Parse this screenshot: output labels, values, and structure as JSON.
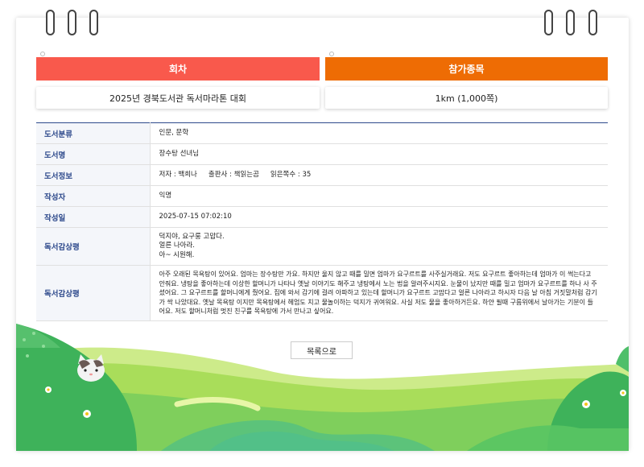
{
  "episode": {
    "header": "회차",
    "value": "2025년 경북도서관 독서마라톤 대회",
    "header_color": "#f9594c"
  },
  "category": {
    "header": "참가종목",
    "value": "1km (1,000쪽)",
    "header_color": "#ee6c04"
  },
  "table": {
    "rows": [
      {
        "label": "도서분류",
        "value": "인문, 문학"
      },
      {
        "label": "도서명",
        "value": "장수탕 선녀님"
      },
      {
        "label": "도서정보",
        "author": "저자 : 백희나",
        "publisher": "출판사 : 책읽는곰",
        "pages": "읽은쪽수 : 35"
      },
      {
        "label": "작성자",
        "value": "익명"
      },
      {
        "label": "작성일",
        "value": "2025-07-15 07:02:10"
      },
      {
        "label": "독서감상평",
        "lines": [
          "덕지야, 요구룽 고맙다.",
          "얼른 나아라.",
          "아~ 시원해."
        ]
      },
      {
        "label": "독서감상평",
        "value": "아주 오래된 목욕탕이 있어요. 엄마는 장수탕만 가요. 하지만 울지 않고 때를 밀면 엄마가 요구르트를 사주실거래요. 저도 요구르트 좋아하는데 엄마가 이 썩는다고 안줘요. 냉탕을 좋아하는데 이상한 할머니가 나타나 옛날 이야기도 해주고 냉탕에서 노는 법을 알려주시지요. 눈물이 났지만 때를 밀고 엄마가 요구르트를 하나 사 주셨어요. 그 요구르트를 할머니에게 줬어요. 집에 와서 감기에 걸려 아파하고 있는데 할머니가 요구르트 고맙다고 얼른 나아라고 하시자 다음 날 아침 거짓말처럼 감기가 싹 나았대요. 옛날 목욕탕 이지만 목욕탕에서 헤엄도 치고 물놀이하는 덕지가 귀여워요. 사실 저도 물을 좋아하거든요. 하얀 필때 구름위에서 날아가는 기분이 들어요. 저도 할머니처럼 멋진 친구를 목욕탕에 가서 만나고 싶어요."
      }
    ]
  },
  "list_button": {
    "label": "목록으로"
  },
  "colors": {
    "accent": "#2e4a8c",
    "grass_dark": "#3eb25a",
    "grass_light": "#a9dd5a"
  }
}
